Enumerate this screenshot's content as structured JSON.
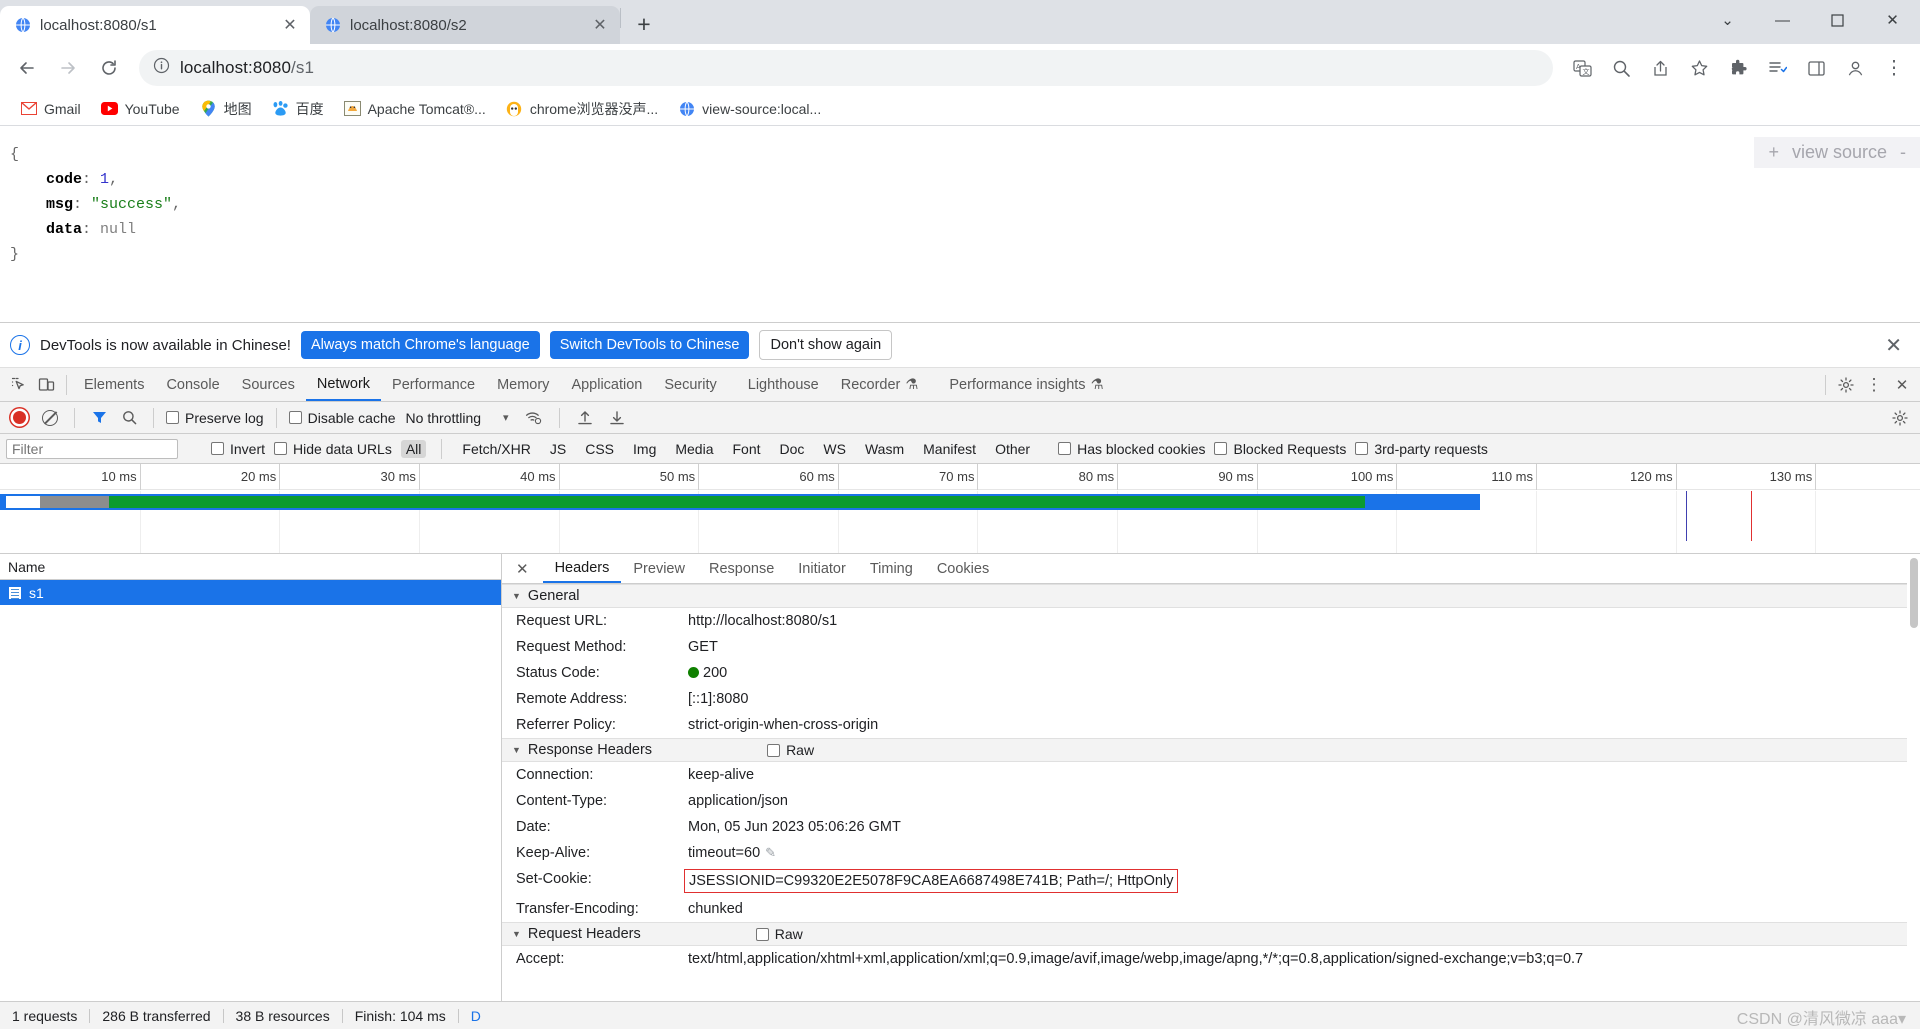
{
  "window": {
    "minimize_label": "—",
    "maximize_label": "❐",
    "close_label": "✕",
    "chevron_label": "⌄"
  },
  "tabs": [
    {
      "title": "localhost:8080/s1",
      "active": true,
      "close_label": "✕",
      "favicon": "globe-icon"
    },
    {
      "title": "localhost:8080/s2",
      "active": false,
      "close_label": "✕",
      "favicon": "globe-icon"
    }
  ],
  "new_tab_label": "+",
  "toolbar": {
    "back_label": "←",
    "forward_label": "→",
    "reload_label": "↻",
    "site_info_label": "ⓘ",
    "url_host": "localhost:8080",
    "url_path": "/s1",
    "url_full": "localhost:8080/s1",
    "translate_label": "translate-icon",
    "zoom_label": "zoom-icon",
    "share_label": "share-icon",
    "bookmark_label": "☆",
    "extensions_label": "extensions-icon",
    "reading_list_label": "reading-list-icon",
    "side_panel_label": "side-panel-icon",
    "profile_label": "profile-icon",
    "menu_label": "⋮"
  },
  "bookmarks": [
    {
      "label": "Gmail",
      "icon": "gmail-icon"
    },
    {
      "label": "YouTube",
      "icon": "youtube-icon"
    },
    {
      "label": "地图",
      "icon": "google-maps-icon"
    },
    {
      "label": "百度",
      "icon": "baidu-icon"
    },
    {
      "label": "Apache Tomcat®...",
      "icon": "tomcat-icon"
    },
    {
      "label": "chrome浏览器没声...",
      "icon": "chrome-ext-icon"
    },
    {
      "label": "view-source:local...",
      "icon": "globe-icon"
    }
  ],
  "page": {
    "view_source": {
      "plus": "+",
      "label": "view source",
      "minus": "-"
    },
    "json_lines": [
      {
        "indent": 0,
        "parts": [
          {
            "t": "punct",
            "s": "{"
          }
        ]
      },
      {
        "indent": 1,
        "parts": [
          {
            "t": "key",
            "s": "code"
          },
          {
            "t": "punct",
            "s": ": "
          },
          {
            "t": "num",
            "s": "1"
          },
          {
            "t": "punct",
            "s": ","
          }
        ]
      },
      {
        "indent": 1,
        "parts": [
          {
            "t": "key",
            "s": "msg"
          },
          {
            "t": "punct",
            "s": ": "
          },
          {
            "t": "str",
            "s": "\"success\""
          },
          {
            "t": "punct",
            "s": ","
          }
        ]
      },
      {
        "indent": 1,
        "parts": [
          {
            "t": "key",
            "s": "data"
          },
          {
            "t": "punct",
            "s": ": "
          },
          {
            "t": "null",
            "s": "null"
          }
        ]
      },
      {
        "indent": 0,
        "parts": [
          {
            "t": "punct",
            "s": "}"
          }
        ]
      }
    ]
  },
  "devtools": {
    "banner": {
      "message": "DevTools is now available in Chinese!",
      "btn_always": "Always match Chrome's language",
      "btn_switch": "Switch DevTools to Chinese",
      "btn_dismiss": "Don't show again",
      "close_label": "✕"
    },
    "panel_tabs": [
      {
        "label": "Elements",
        "selected": false
      },
      {
        "label": "Console",
        "selected": false
      },
      {
        "label": "Sources",
        "selected": false
      },
      {
        "label": "Network",
        "selected": true
      },
      {
        "label": "Performance",
        "selected": false
      },
      {
        "label": "Memory",
        "selected": false
      },
      {
        "label": "Application",
        "selected": false
      },
      {
        "label": "Security",
        "selected": false
      },
      {
        "label": "Lighthouse",
        "selected": false
      },
      {
        "label": "Recorder",
        "selected": false,
        "badge": "⚗"
      },
      {
        "label": "Performance insights",
        "selected": false,
        "badge": "⚗"
      }
    ],
    "panel_tabs_right": {
      "settings_label": "⚙",
      "more_label": "⋮",
      "close_label": "✕"
    },
    "network_toolbar": {
      "record_label": "record-button",
      "clear_label": "clear-button",
      "filter_label": "filter-icon",
      "search_label": "search-icon",
      "preserve_log": "Preserve log",
      "disable_cache": "Disable cache",
      "throttling": "No throttling",
      "throttle_caret": "▾",
      "wifi_label": "network-conditions-icon",
      "import_label": "import-har-icon",
      "export_label": "export-har-icon",
      "settings_label": "⚙"
    },
    "filter_bar": {
      "filter_placeholder": "Filter",
      "filter_value": "",
      "invert": "Invert",
      "hide_data_urls": "Hide data URLs",
      "types": [
        "All",
        "Fetch/XHR",
        "JS",
        "CSS",
        "Img",
        "Media",
        "Font",
        "Doc",
        "WS",
        "Wasm",
        "Manifest",
        "Other"
      ],
      "selected_type": "All",
      "has_blocked_cookies": "Has blocked cookies",
      "blocked_requests": "Blocked Requests",
      "third_party_requests": "3rd-party requests"
    },
    "overview": {
      "ticks": [
        "10 ms",
        "20 ms",
        "30 ms",
        "40 ms",
        "50 ms",
        "60 ms",
        "70 ms",
        "80 ms",
        "90 ms",
        "100 ms",
        "110 ms",
        "120 ms",
        "130 ms"
      ],
      "bands": [
        {
          "name": "stalled",
          "color": "#ffffff",
          "start_pct": 0.3,
          "width_pct": 1.8
        },
        {
          "name": "waiting",
          "color": "#8d8d8d",
          "start_pct": 2.1,
          "width_pct": 3.6
        },
        {
          "name": "download",
          "color": "#0b9b2f",
          "start_pct": 5.7,
          "width_pct": 65.4
        },
        {
          "name": "tail",
          "color": "#1a73e8",
          "start_pct": 71.1,
          "width_pct": 3.0
        }
      ],
      "markers": [
        {
          "name": "dom-content-loaded",
          "color": "#4040b0",
          "pos_pct": 87.8
        },
        {
          "name": "load",
          "color": "#e03030",
          "pos_pct": 91.2
        }
      ]
    },
    "request_list": {
      "column_header": "Name",
      "rows": [
        {
          "name": "s1",
          "selected": true,
          "icon": "document-icon"
        }
      ]
    },
    "detail": {
      "close_label": "✕",
      "tabs": [
        {
          "label": "Headers",
          "selected": true
        },
        {
          "label": "Preview",
          "selected": false
        },
        {
          "label": "Response",
          "selected": false
        },
        {
          "label": "Initiator",
          "selected": false
        },
        {
          "label": "Timing",
          "selected": false
        },
        {
          "label": "Cookies",
          "selected": false
        }
      ],
      "sections": [
        {
          "title": "General",
          "has_raw": false,
          "raw_label": "",
          "rows": [
            {
              "key": "Request URL:",
              "value": "http://localhost:8080/s1"
            },
            {
              "key": "Request Method:",
              "value": "GET"
            },
            {
              "key": "Status Code:",
              "value": "200",
              "status_dot": true
            },
            {
              "key": "Remote Address:",
              "value": "[::1]:8080"
            },
            {
              "key": "Referrer Policy:",
              "value": "strict-origin-when-cross-origin"
            }
          ]
        },
        {
          "title": "Response Headers",
          "has_raw": true,
          "raw_label": "Raw",
          "rows": [
            {
              "key": "Connection:",
              "value": "keep-alive"
            },
            {
              "key": "Content-Type:",
              "value": "application/json"
            },
            {
              "key": "Date:",
              "value": "Mon, 05 Jun 2023 05:06:26 GMT"
            },
            {
              "key": "Keep-Alive:",
              "value": "timeout=60",
              "pencil": true
            },
            {
              "key": "Set-Cookie:",
              "value": "JSESSIONID=C99320E2E5078F9CA8EA6687498E741B; Path=/; HttpOnly",
              "highlight": true
            },
            {
              "key": "Transfer-Encoding:",
              "value": "chunked"
            }
          ]
        },
        {
          "title": "Request Headers",
          "has_raw": true,
          "raw_label": "Raw",
          "rows": [
            {
              "key": "Accept:",
              "value": "text/html,application/xhtml+xml,application/xml;q=0.9,image/avif,image/webp,image/apng,*/*;q=0.8,application/signed-exchange;v=b3;q=0.7"
            }
          ]
        }
      ]
    },
    "status_bar": {
      "requests": "1 requests",
      "transferred": "286 B transferred",
      "resources": "38 B resources",
      "finish": "Finish: 104 ms",
      "truncated": "D"
    },
    "watermark": "CSDN @清风微凉 aaa▾"
  },
  "colors": {
    "accent": "#1a73e8",
    "record": "#d93025",
    "ok_green": "#0f8000",
    "download_green": "#0b9b2f",
    "highlight_red": "#e03030"
  }
}
